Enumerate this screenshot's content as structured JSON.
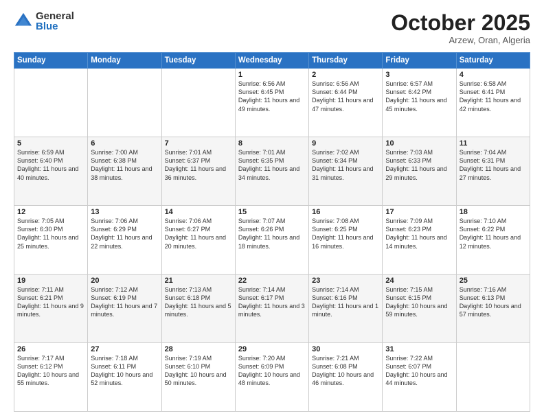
{
  "header": {
    "logo_general": "General",
    "logo_blue": "Blue",
    "month": "October 2025",
    "location": "Arzew, Oran, Algeria"
  },
  "days_of_week": [
    "Sunday",
    "Monday",
    "Tuesday",
    "Wednesday",
    "Thursday",
    "Friday",
    "Saturday"
  ],
  "weeks": [
    [
      {
        "day": "",
        "text": ""
      },
      {
        "day": "",
        "text": ""
      },
      {
        "day": "",
        "text": ""
      },
      {
        "day": "1",
        "text": "Sunrise: 6:56 AM\nSunset: 6:45 PM\nDaylight: 11 hours and 49 minutes."
      },
      {
        "day": "2",
        "text": "Sunrise: 6:56 AM\nSunset: 6:44 PM\nDaylight: 11 hours and 47 minutes."
      },
      {
        "day": "3",
        "text": "Sunrise: 6:57 AM\nSunset: 6:42 PM\nDaylight: 11 hours and 45 minutes."
      },
      {
        "day": "4",
        "text": "Sunrise: 6:58 AM\nSunset: 6:41 PM\nDaylight: 11 hours and 42 minutes."
      }
    ],
    [
      {
        "day": "5",
        "text": "Sunrise: 6:59 AM\nSunset: 6:40 PM\nDaylight: 11 hours and 40 minutes."
      },
      {
        "day": "6",
        "text": "Sunrise: 7:00 AM\nSunset: 6:38 PM\nDaylight: 11 hours and 38 minutes."
      },
      {
        "day": "7",
        "text": "Sunrise: 7:01 AM\nSunset: 6:37 PM\nDaylight: 11 hours and 36 minutes."
      },
      {
        "day": "8",
        "text": "Sunrise: 7:01 AM\nSunset: 6:35 PM\nDaylight: 11 hours and 34 minutes."
      },
      {
        "day": "9",
        "text": "Sunrise: 7:02 AM\nSunset: 6:34 PM\nDaylight: 11 hours and 31 minutes."
      },
      {
        "day": "10",
        "text": "Sunrise: 7:03 AM\nSunset: 6:33 PM\nDaylight: 11 hours and 29 minutes."
      },
      {
        "day": "11",
        "text": "Sunrise: 7:04 AM\nSunset: 6:31 PM\nDaylight: 11 hours and 27 minutes."
      }
    ],
    [
      {
        "day": "12",
        "text": "Sunrise: 7:05 AM\nSunset: 6:30 PM\nDaylight: 11 hours and 25 minutes."
      },
      {
        "day": "13",
        "text": "Sunrise: 7:06 AM\nSunset: 6:29 PM\nDaylight: 11 hours and 22 minutes."
      },
      {
        "day": "14",
        "text": "Sunrise: 7:06 AM\nSunset: 6:27 PM\nDaylight: 11 hours and 20 minutes."
      },
      {
        "day": "15",
        "text": "Sunrise: 7:07 AM\nSunset: 6:26 PM\nDaylight: 11 hours and 18 minutes."
      },
      {
        "day": "16",
        "text": "Sunrise: 7:08 AM\nSunset: 6:25 PM\nDaylight: 11 hours and 16 minutes."
      },
      {
        "day": "17",
        "text": "Sunrise: 7:09 AM\nSunset: 6:23 PM\nDaylight: 11 hours and 14 minutes."
      },
      {
        "day": "18",
        "text": "Sunrise: 7:10 AM\nSunset: 6:22 PM\nDaylight: 11 hours and 12 minutes."
      }
    ],
    [
      {
        "day": "19",
        "text": "Sunrise: 7:11 AM\nSunset: 6:21 PM\nDaylight: 11 hours and 9 minutes."
      },
      {
        "day": "20",
        "text": "Sunrise: 7:12 AM\nSunset: 6:19 PM\nDaylight: 11 hours and 7 minutes."
      },
      {
        "day": "21",
        "text": "Sunrise: 7:13 AM\nSunset: 6:18 PM\nDaylight: 11 hours and 5 minutes."
      },
      {
        "day": "22",
        "text": "Sunrise: 7:14 AM\nSunset: 6:17 PM\nDaylight: 11 hours and 3 minutes."
      },
      {
        "day": "23",
        "text": "Sunrise: 7:14 AM\nSunset: 6:16 PM\nDaylight: 11 hours and 1 minute."
      },
      {
        "day": "24",
        "text": "Sunrise: 7:15 AM\nSunset: 6:15 PM\nDaylight: 10 hours and 59 minutes."
      },
      {
        "day": "25",
        "text": "Sunrise: 7:16 AM\nSunset: 6:13 PM\nDaylight: 10 hours and 57 minutes."
      }
    ],
    [
      {
        "day": "26",
        "text": "Sunrise: 7:17 AM\nSunset: 6:12 PM\nDaylight: 10 hours and 55 minutes."
      },
      {
        "day": "27",
        "text": "Sunrise: 7:18 AM\nSunset: 6:11 PM\nDaylight: 10 hours and 52 minutes."
      },
      {
        "day": "28",
        "text": "Sunrise: 7:19 AM\nSunset: 6:10 PM\nDaylight: 10 hours and 50 minutes."
      },
      {
        "day": "29",
        "text": "Sunrise: 7:20 AM\nSunset: 6:09 PM\nDaylight: 10 hours and 48 minutes."
      },
      {
        "day": "30",
        "text": "Sunrise: 7:21 AM\nSunset: 6:08 PM\nDaylight: 10 hours and 46 minutes."
      },
      {
        "day": "31",
        "text": "Sunrise: 7:22 AM\nSunset: 6:07 PM\nDaylight: 10 hours and 44 minutes."
      },
      {
        "day": "",
        "text": ""
      }
    ]
  ]
}
